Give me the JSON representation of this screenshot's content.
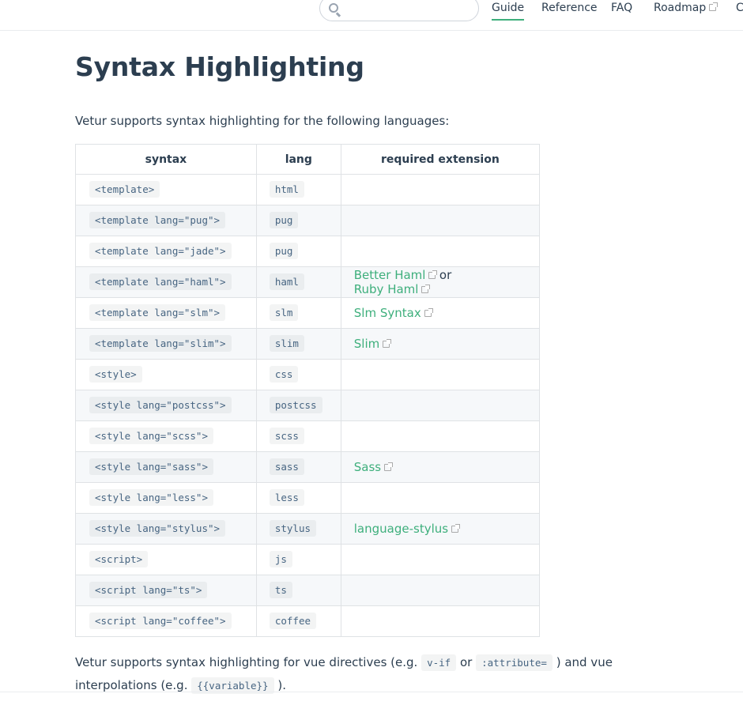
{
  "nav": {
    "search": {
      "placeholder": "",
      "value": ""
    },
    "links": [
      {
        "label": "Guide",
        "active": true,
        "external": false
      },
      {
        "label": "Reference",
        "active": false,
        "external": false
      },
      {
        "label": "FAQ",
        "active": false,
        "external": false
      },
      {
        "label": "Roadmap",
        "active": false,
        "external": true
      },
      {
        "label": "C",
        "active": false,
        "external": false
      }
    ],
    "accent_color": "#3eaf7c"
  },
  "page": {
    "title": "Syntax Highlighting",
    "intro": "Vetur supports syntax highlighting for the following languages:",
    "table": {
      "headers": [
        "syntax",
        "lang",
        "required extension"
      ],
      "rows": [
        {
          "syntax": "<template>",
          "lang": "html",
          "ext": []
        },
        {
          "syntax": "<template lang=\"pug\">",
          "lang": "pug",
          "ext": []
        },
        {
          "syntax": "<template lang=\"jade\">",
          "lang": "pug",
          "ext": []
        },
        {
          "syntax": "<template lang=\"haml\">",
          "lang": "haml",
          "ext": [
            "Better Haml",
            "Ruby Haml"
          ],
          "joiner": "or"
        },
        {
          "syntax": "<template lang=\"slm\">",
          "lang": "slm",
          "ext": [
            "Slm Syntax"
          ]
        },
        {
          "syntax": "<template lang=\"slim\">",
          "lang": "slim",
          "ext": [
            "Slim"
          ]
        },
        {
          "syntax": "<style>",
          "lang": "css",
          "ext": []
        },
        {
          "syntax": "<style lang=\"postcss\">",
          "lang": "postcss",
          "ext": []
        },
        {
          "syntax": "<style lang=\"scss\">",
          "lang": "scss",
          "ext": []
        },
        {
          "syntax": "<style lang=\"sass\">",
          "lang": "sass",
          "ext": [
            "Sass"
          ]
        },
        {
          "syntax": "<style lang=\"less\">",
          "lang": "less",
          "ext": []
        },
        {
          "syntax": "<style lang=\"stylus\">",
          "lang": "stylus",
          "ext": [
            "language-stylus"
          ]
        },
        {
          "syntax": "<script>",
          "lang": "js",
          "ext": []
        },
        {
          "syntax": "<script lang=\"ts\">",
          "lang": "ts",
          "ext": []
        },
        {
          "syntax": "<script lang=\"coffee\">",
          "lang": "coffee",
          "ext": []
        }
      ]
    },
    "outro": {
      "part1": "Vetur supports syntax highlighting for vue directives (e.g.",
      "code1": "v-if",
      "part2": "or",
      "code2": ":attribute=",
      "part3": ") and vue",
      "part4": "interpolations (e.g.",
      "code3": "{{variable}}",
      "part5": ")."
    }
  }
}
